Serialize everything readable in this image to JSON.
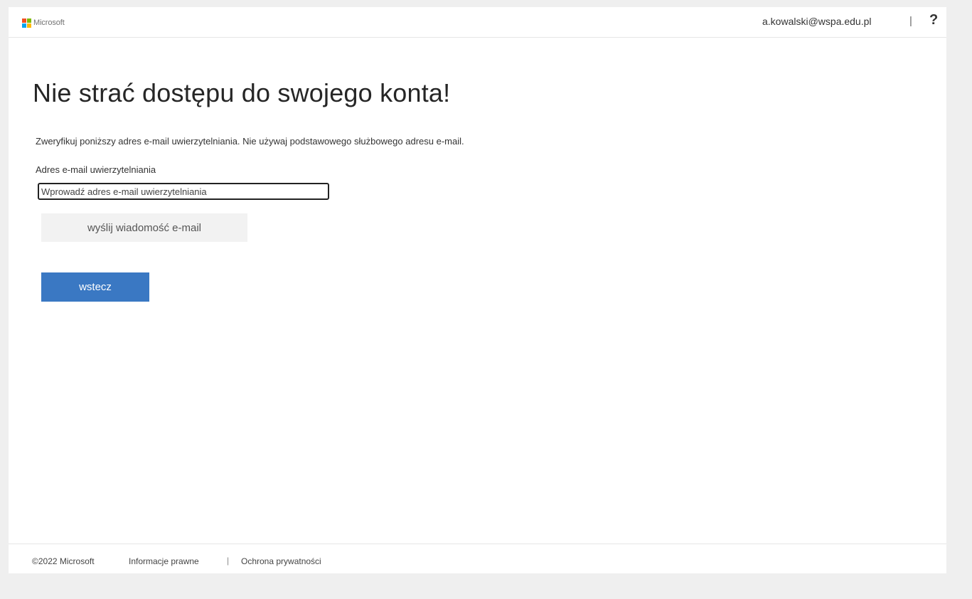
{
  "header": {
    "logo_text": "Microsoft",
    "logo_colors": [
      "#f25022",
      "#7fba00",
      "#00a4ef",
      "#ffb900"
    ],
    "user_email": "a.kowalski@wspa.edu.pl",
    "divider": "|",
    "help_glyph": "?"
  },
  "main": {
    "title": "Nie strać dostępu do swojego konta!",
    "instructions": "Zweryfikuj poniższy adres e-mail uwierzytelniania. Nie używaj podstawowego służbowego adresu e-mail.",
    "field_label": "Adres e-mail uwierzytelniania",
    "email_value": "",
    "email_placeholder": "Wprowadź adres e-mail uwierzytelniania",
    "send_label": "wyślij wiadomość e-mail",
    "back_label": "wstecz",
    "accent_color": "#3a78c3"
  },
  "footer": {
    "copyright": "©2022 Microsoft",
    "legal": "Informacje prawne",
    "separator": "|",
    "privacy": "Ochrona prywatności"
  }
}
